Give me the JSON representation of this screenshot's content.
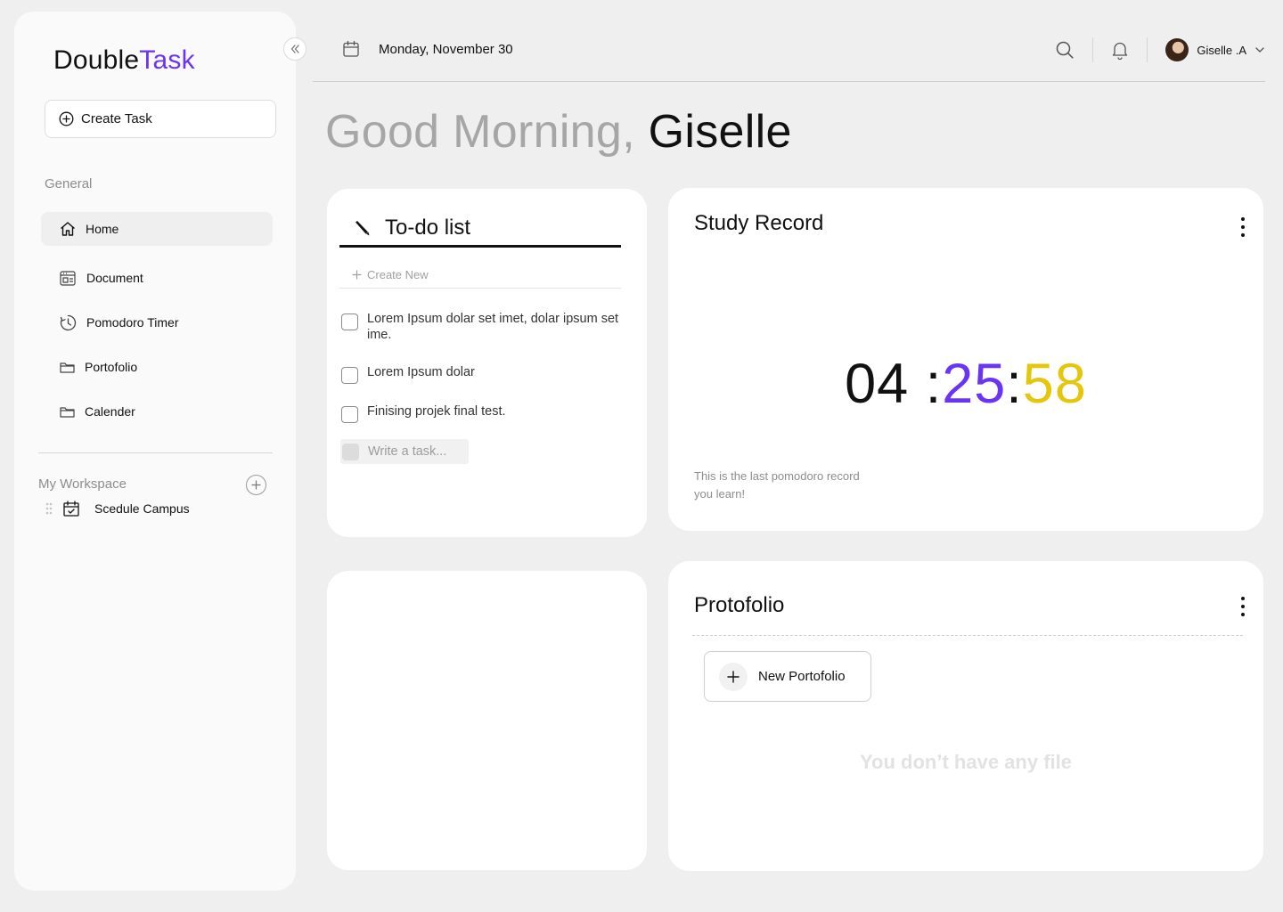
{
  "app": {
    "logo_part1": "Double",
    "logo_part2": "Task",
    "accent_color": "#6a34f5",
    "timer_seconds_color": "#e5c60c"
  },
  "sidebar": {
    "create_task_label": "Create Task",
    "general_label": "General",
    "nav": [
      {
        "label": "Home",
        "icon": "home-icon",
        "active": true
      },
      {
        "label": "Document",
        "icon": "document-icon"
      },
      {
        "label": "Pomodoro Timer",
        "icon": "clock-icon"
      },
      {
        "label": "Portofolio",
        "icon": "folder-icon"
      },
      {
        "label": "Calender",
        "icon": "folder-icon"
      }
    ],
    "workspace_label": "My Workspace",
    "workspace_items": [
      {
        "label": "Scedule Campus",
        "icon": "calendar-check-icon"
      }
    ]
  },
  "topbar": {
    "date": "Monday, November 30",
    "user_name": "Giselle .A"
  },
  "greeting": {
    "prefix": "Good Morning,",
    "name": "Giselle"
  },
  "todo": {
    "title": "To-do list",
    "create_new": "Create New",
    "items": [
      "Lorem Ipsum dolar set imet, dolar ipsum set ime.",
      "Lorem Ipsum dolar",
      "Finising projek final test."
    ],
    "write_placeholder": "Write a task..."
  },
  "study": {
    "title": "Study Record",
    "hours": "04",
    "minutes": "25",
    "seconds": "58",
    "note": "This is the last pomodoro record you learn!"
  },
  "portfolio": {
    "title": "Protofolio",
    "new_button": "New Portofolio",
    "empty_text": "You don’t have any file"
  }
}
